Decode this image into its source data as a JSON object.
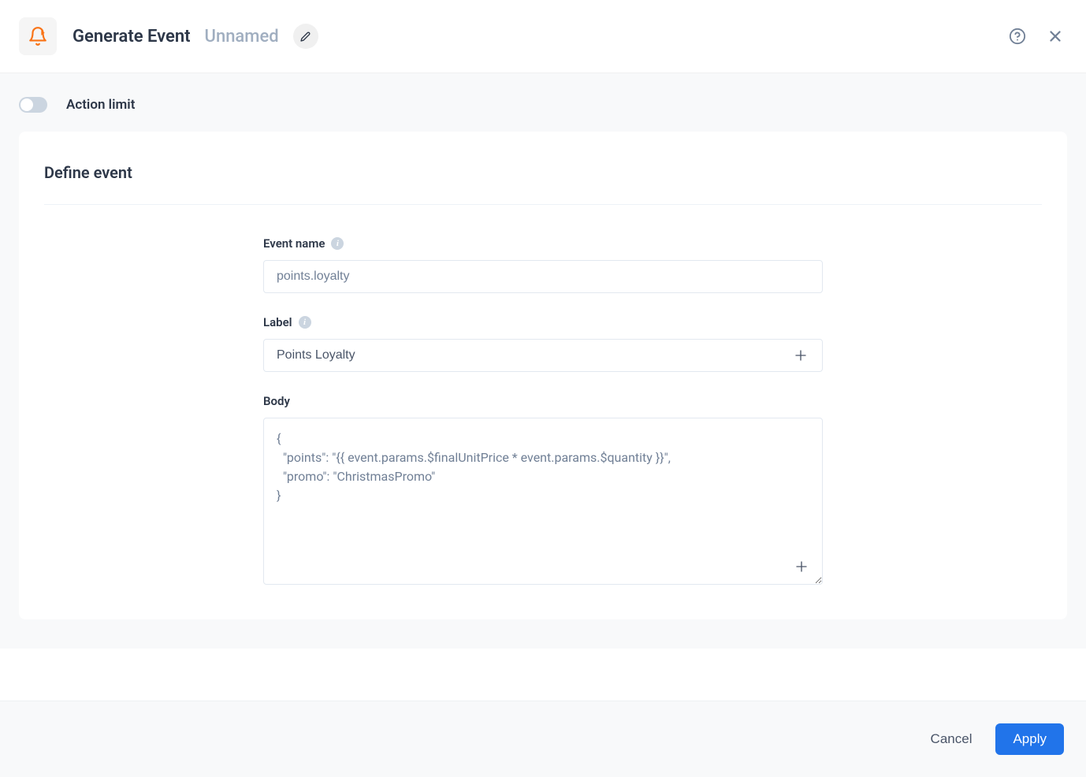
{
  "header": {
    "title": "Generate Event",
    "subtitle": "Unnamed"
  },
  "actionLimit": {
    "label": "Action limit",
    "enabled": false
  },
  "defineEvent": {
    "title": "Define event",
    "eventName": {
      "label": "Event name",
      "value": "points.loyalty"
    },
    "labelField": {
      "label": "Label",
      "value": "Points Loyalty"
    },
    "body": {
      "label": "Body",
      "value": "{\n  \"points\": \"{{ event.params.$finalUnitPrice * event.params.$quantity }}\",\n  \"promo\": \"ChristmasPromo\"\n}"
    }
  },
  "footer": {
    "cancel": "Cancel",
    "apply": "Apply"
  }
}
